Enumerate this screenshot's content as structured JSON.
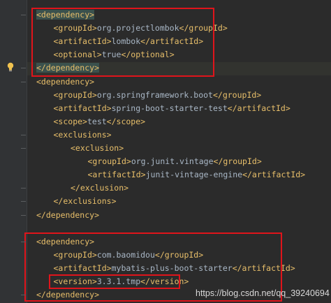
{
  "code_lines": [
    {
      "indent": 0,
      "parts": [
        {
          "t": "tag",
          "v": "<dependency>",
          "hl": true
        }
      ]
    },
    {
      "indent": 1,
      "parts": [
        {
          "t": "tag",
          "v": "<groupId>"
        },
        {
          "t": "text",
          "v": "org.projectlombok"
        },
        {
          "t": "tag",
          "v": "</groupId>"
        }
      ]
    },
    {
      "indent": 1,
      "parts": [
        {
          "t": "tag",
          "v": "<artifactId>"
        },
        {
          "t": "text",
          "v": "lombok"
        },
        {
          "t": "tag",
          "v": "</artifactId>"
        }
      ]
    },
    {
      "indent": 1,
      "parts": [
        {
          "t": "tag",
          "v": "<optional>"
        },
        {
          "t": "text",
          "v": "true"
        },
        {
          "t": "tag",
          "v": "</optional>"
        }
      ]
    },
    {
      "indent": 0,
      "parts": [
        {
          "t": "tag",
          "v": "</dependency>",
          "hl": true
        }
      ]
    },
    {
      "indent": 0,
      "parts": [
        {
          "t": "tag",
          "v": "<dependency>"
        }
      ]
    },
    {
      "indent": 1,
      "parts": [
        {
          "t": "tag",
          "v": "<groupId>"
        },
        {
          "t": "text",
          "v": "org.springframework.boot"
        },
        {
          "t": "tag",
          "v": "</groupId>"
        }
      ]
    },
    {
      "indent": 1,
      "parts": [
        {
          "t": "tag",
          "v": "<artifactId>"
        },
        {
          "t": "text",
          "v": "spring-boot-starter-test"
        },
        {
          "t": "tag",
          "v": "</artifactId>"
        }
      ]
    },
    {
      "indent": 1,
      "parts": [
        {
          "t": "tag",
          "v": "<scope>"
        },
        {
          "t": "text",
          "v": "test"
        },
        {
          "t": "tag",
          "v": "</scope>"
        }
      ]
    },
    {
      "indent": 1,
      "parts": [
        {
          "t": "tag",
          "v": "<exclusions>"
        }
      ]
    },
    {
      "indent": 2,
      "parts": [
        {
          "t": "tag",
          "v": "<exclusion>"
        }
      ]
    },
    {
      "indent": 3,
      "parts": [
        {
          "t": "tag",
          "v": "<groupId>"
        },
        {
          "t": "text",
          "v": "org.junit.vintage"
        },
        {
          "t": "tag",
          "v": "</groupId>"
        }
      ]
    },
    {
      "indent": 3,
      "parts": [
        {
          "t": "tag",
          "v": "<artifactId>"
        },
        {
          "t": "text",
          "v": "junit-vintage-engine"
        },
        {
          "t": "tag",
          "v": "</artifactId>"
        }
      ]
    },
    {
      "indent": 2,
      "parts": [
        {
          "t": "tag",
          "v": "</exclusion>"
        }
      ]
    },
    {
      "indent": 1,
      "parts": [
        {
          "t": "tag",
          "v": "</exclusions>"
        }
      ]
    },
    {
      "indent": 0,
      "parts": [
        {
          "t": "tag",
          "v": "</dependency>"
        }
      ]
    },
    {
      "indent": 0,
      "parts": []
    },
    {
      "indent": 0,
      "parts": [
        {
          "t": "tag",
          "v": "<dependency>"
        }
      ]
    },
    {
      "indent": 1,
      "parts": [
        {
          "t": "tag",
          "v": "<groupId>"
        },
        {
          "t": "text",
          "v": "com.baomidou"
        },
        {
          "t": "tag",
          "v": "</groupId>"
        }
      ]
    },
    {
      "indent": 1,
      "parts": [
        {
          "t": "tag",
          "v": "<artifactId>"
        },
        {
          "t": "text",
          "v": "mybatis-plus-boot-starter"
        },
        {
          "t": "tag",
          "v": "</artifactId>"
        }
      ]
    },
    {
      "indent": 1,
      "parts": [
        {
          "t": "tag",
          "v": "<version>"
        },
        {
          "t": "text",
          "v": "3.3.1.tmp"
        },
        {
          "t": "tag",
          "v": "</version>"
        }
      ]
    },
    {
      "indent": 0,
      "parts": [
        {
          "t": "tag",
          "v": "</dependency>"
        }
      ]
    }
  ],
  "watermark": "https://blog.csdn.net/qq_39240694",
  "icons": {
    "intention": "lightbulb-icon"
  },
  "colors": {
    "background": "#2b2b2b",
    "gutter": "#313335",
    "tag": "#e8bf6a",
    "text": "#a9b7c6",
    "annotation_box": "#e0141b"
  }
}
